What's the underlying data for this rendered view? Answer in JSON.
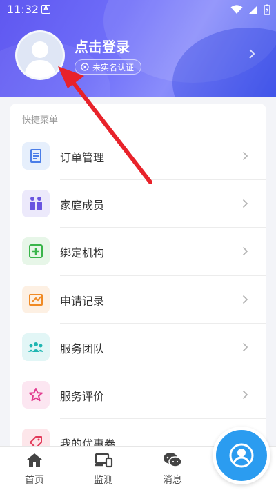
{
  "status": {
    "time": "11:32"
  },
  "profile": {
    "title": "点击登录",
    "badge": "未实名认证"
  },
  "menu": {
    "title": "快捷菜单",
    "items": [
      {
        "label": "订单管理",
        "icon": "order-icon",
        "color": "#4a7de8",
        "bg": "#e6effc"
      },
      {
        "label": "家庭成员",
        "icon": "family-icon",
        "color": "#6a55e0",
        "bg": "#ece9fb"
      },
      {
        "label": "绑定机构",
        "icon": "plus-box-icon",
        "color": "#39b54a",
        "bg": "#e7f6e8"
      },
      {
        "label": "申请记录",
        "icon": "record-icon",
        "color": "#f08a24",
        "bg": "#fdf0e3"
      },
      {
        "label": "服务团队",
        "icon": "team-icon",
        "color": "#1fb6b2",
        "bg": "#e2f6f6"
      },
      {
        "label": "服务评价",
        "icon": "star-icon",
        "color": "#e23b8f",
        "bg": "#fce6f1"
      },
      {
        "label": "我的优惠券",
        "icon": "coupon-icon",
        "color": "#e23b5a",
        "bg": "#fde6ea"
      }
    ]
  },
  "tabs": [
    {
      "label": "首页",
      "icon": "home-icon"
    },
    {
      "label": "监测",
      "icon": "devices-icon"
    },
    {
      "label": "消息",
      "icon": "chat-icon"
    }
  ]
}
